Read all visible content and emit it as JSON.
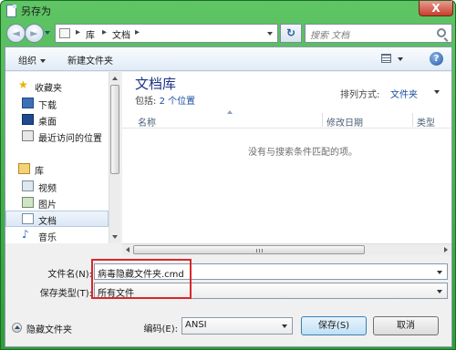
{
  "window": {
    "title": "另存为",
    "close_glyph": "X"
  },
  "nav": {
    "back_glyph": "◄",
    "forward_glyph": "►",
    "breadcrumb": [
      "库",
      "文档"
    ],
    "crumb_sep": "▸",
    "refresh_glyph": "↻",
    "search_placeholder": "搜索 文档"
  },
  "toolbar": {
    "organize": "组织",
    "new_folder": "新建文件夹",
    "help": "?"
  },
  "sidebar": {
    "favorites_header": "收藏夹",
    "favorites": [
      "下载",
      "桌面",
      "最近访问的位置"
    ],
    "libraries_header": "库",
    "libraries": [
      "视频",
      "图片",
      "文档",
      "音乐"
    ]
  },
  "content": {
    "library_title": "文档库",
    "includes_label": "包括:",
    "includes_link": "2 个位置",
    "sort_label": "排列方式:",
    "sort_value": "文件夹",
    "columns": [
      "名称",
      "修改日期",
      "类型"
    ],
    "empty_message": "没有与搜索条件匹配的项。"
  },
  "form": {
    "filename_label": "文件名(N):",
    "filename_value": "病毒隐藏文件夹.cmd",
    "filetype_label": "保存类型(T):",
    "filetype_value": "所有文件",
    "encoding_label": "编码(E):",
    "encoding_value": "ANSI"
  },
  "footer": {
    "hide_folders": "隐藏文件夹",
    "save": "保存(S)",
    "cancel": "取消"
  },
  "colors": {
    "titlebar": "#3aa844",
    "highlight": "#d8282a",
    "library_title": "#1e3287",
    "link": "#1a4fa0"
  }
}
